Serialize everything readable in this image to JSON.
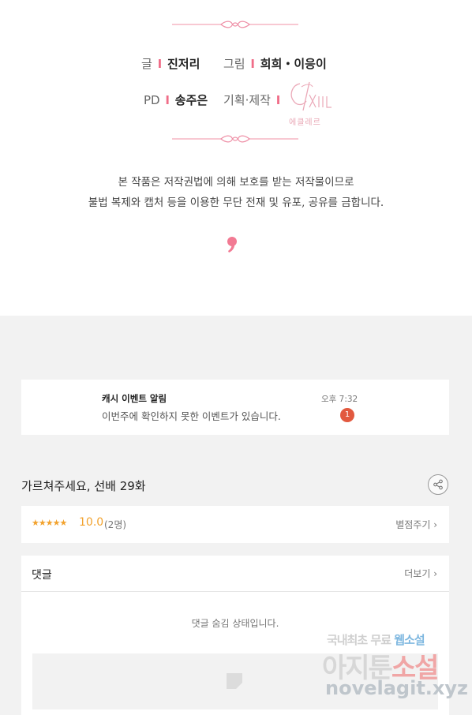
{
  "credits": {
    "writer_label": "글",
    "writer_name": "진저리",
    "art_label": "그림",
    "art_names": "희희・이응이",
    "pd_label": "PD",
    "pd_name": "송주은",
    "production_label": "기획·제작",
    "bar": "I",
    "studio_logo_text": "에클레르"
  },
  "copyright_notice": {
    "line1": "본 작품은 저작권법에 의해 보호를 받는 저작물이므로",
    "line2": "불법 복제와 캡처 등을 이용한 무단 전재 및 유포, 공유를 금합니다."
  },
  "notification": {
    "title": "캐시 이벤트 알림",
    "message": "이번주에 확인하지 못한 이벤트가 있습니다.",
    "time": "오후 7:32",
    "badge_count": "1"
  },
  "episode": {
    "title": "가르쳐주세요, 선배 29화"
  },
  "rating": {
    "stars": "★★★★★",
    "score": "10.0",
    "count": "(2명)",
    "rate_link": "별점주기 ›"
  },
  "comments": {
    "title": "댓글",
    "more_link": "더보기 ›",
    "hidden_message": "댓글 숨김 상태입니다."
  },
  "watermark": {
    "line1_a": "국내최초 무료 ",
    "line1_b": "웹소설",
    "line2_a": "아지툰",
    "line2_b": "소설",
    "line3": "novelagit.xyz"
  },
  "colors": {
    "accent_pink": "#f06d88",
    "star_orange": "#f2a22d",
    "badge_red": "#e2593f",
    "page_gray": "#f2f2f2"
  },
  "icons": {
    "share": "share-icon",
    "comma": "comma-mark-icon",
    "divider": "ornamental-divider-icon"
  }
}
